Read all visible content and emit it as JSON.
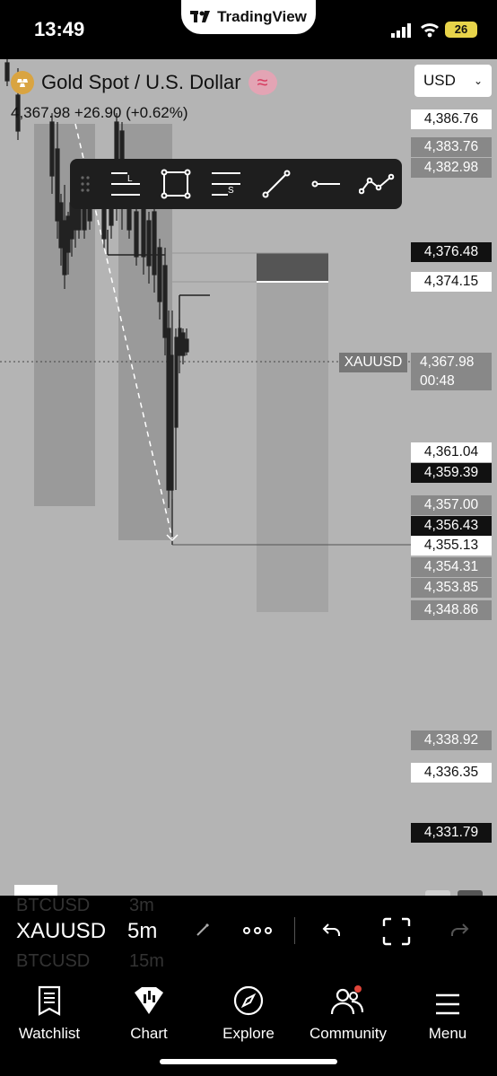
{
  "status_bar": {
    "time": "13:49",
    "brand": "TradingView",
    "battery": "26"
  },
  "chart": {
    "symbol_name": "Gold Spot / U.S. Dollar",
    "quote": "4,367.98 +26.90 (+0.62%)",
    "currency": "USD",
    "symbol_tag": "XAUUSD",
    "price": "4,367.98",
    "countdown": "00:48",
    "price_labels": [
      {
        "text": "4,386.76",
        "style": "white"
      },
      {
        "text": "4,383.76",
        "style": "gray"
      },
      {
        "text": "4,382.98",
        "style": "gray"
      },
      {
        "text": "4,376.48",
        "style": "black"
      },
      {
        "text": "4,374.15",
        "style": "white"
      },
      {
        "text": "4,361.04",
        "style": "white"
      },
      {
        "text": "4,359.39",
        "style": "black"
      },
      {
        "text": "4,357.00",
        "style": "gray"
      },
      {
        "text": "4,356.43",
        "style": "black"
      },
      {
        "text": "4,355.13",
        "style": "white"
      },
      {
        "text": "4,354.31",
        "style": "gray"
      },
      {
        "text": "4,353.85",
        "style": "gray"
      },
      {
        "text": "4,348.86",
        "style": "gray"
      },
      {
        "text": "4,338.92",
        "style": "gray"
      },
      {
        "text": "4,336.35",
        "style": "white"
      },
      {
        "text": "4,331.79",
        "style": "black"
      }
    ],
    "drawing_toolbar": [
      "drag-handle",
      "long-position-tool",
      "rectangle-tool",
      "short-position-tool",
      "trend-line-tool",
      "horizontal-ray-tool",
      "path-tool"
    ]
  },
  "symbol_bar": {
    "prev_symbol": "BTCUSD",
    "prev_interval": "3m",
    "symbol": "XAUUSD",
    "interval": "5m",
    "next_symbol": "BTCUSD",
    "next_interval": "15m"
  },
  "nav": {
    "watchlist": "Watchlist",
    "chart": "Chart",
    "explore": "Explore",
    "community": "Community",
    "menu": "Menu"
  }
}
